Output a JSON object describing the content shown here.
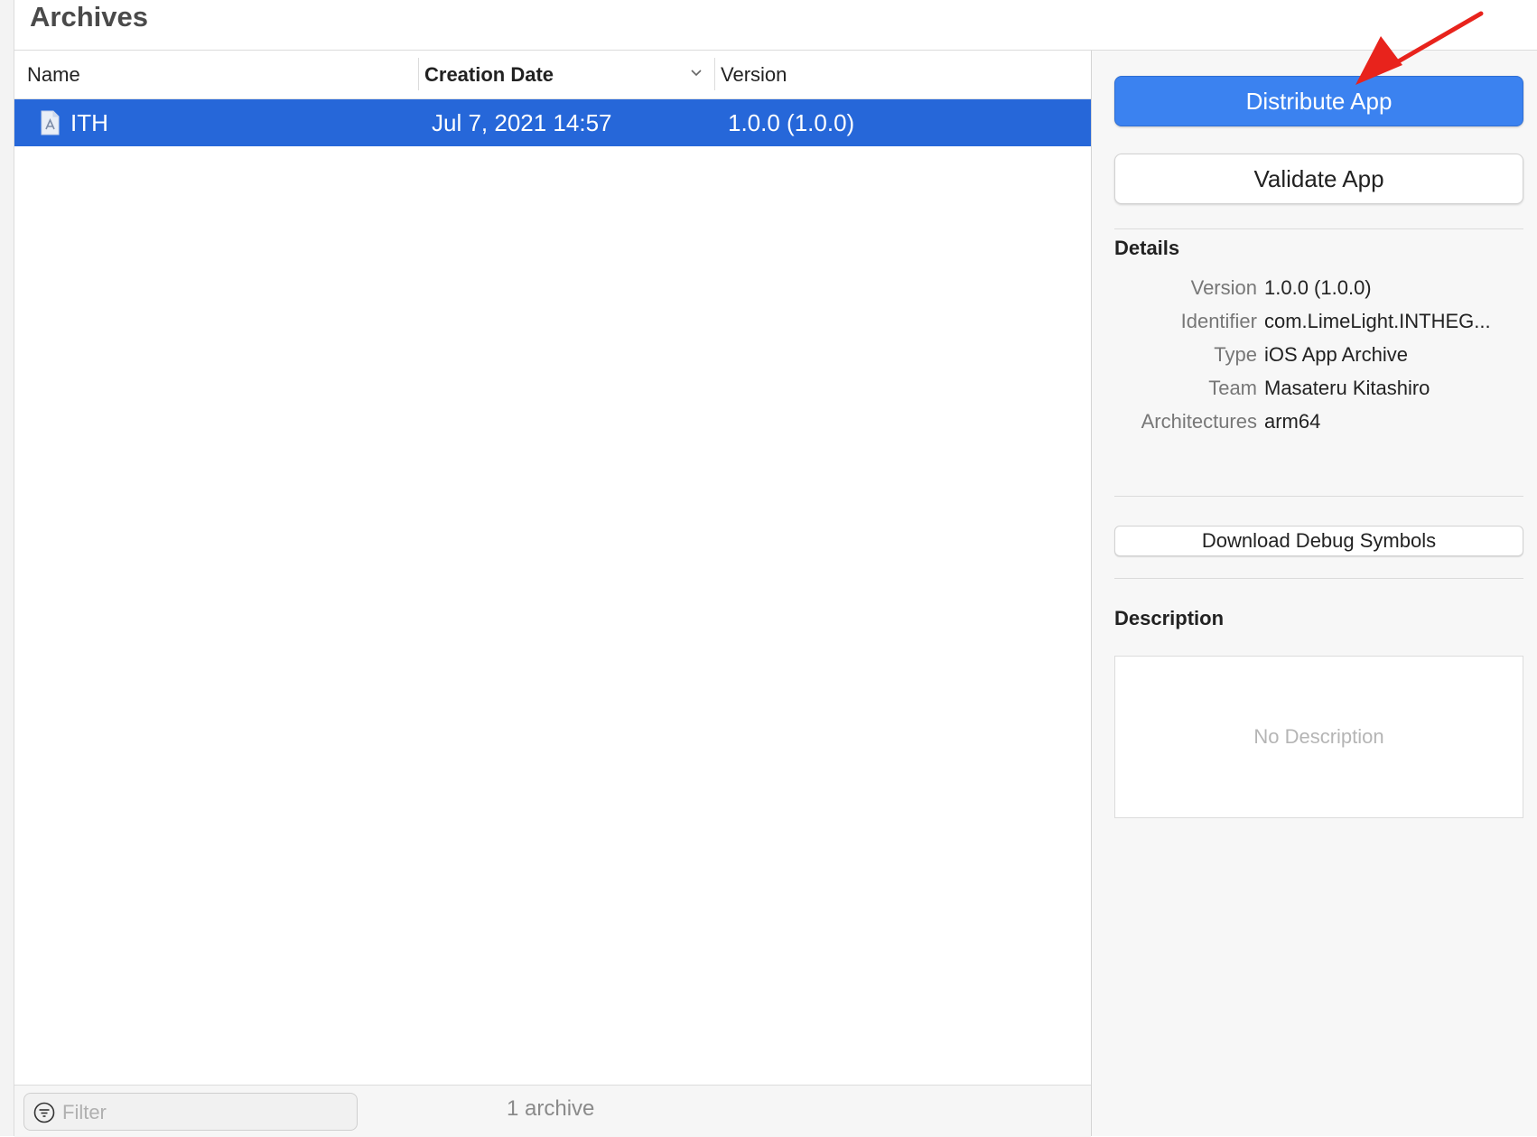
{
  "window": {
    "title": "Archives"
  },
  "columns": {
    "name": "Name",
    "creation_date": "Creation Date",
    "version": "Version"
  },
  "archives": [
    {
      "name": "ITH",
      "date": "Jul 7, 2021 14:57",
      "version": "1.0.0 (1.0.0)",
      "selected": true
    }
  ],
  "footer": {
    "filter_placeholder": "Filter",
    "count": "1 archive"
  },
  "actions": {
    "distribute": "Distribute App",
    "validate": "Validate App",
    "download_symbols": "Download Debug Symbols"
  },
  "details": {
    "title": "Details",
    "rows": [
      {
        "key": "Version",
        "value": "1.0.0 (1.0.0)"
      },
      {
        "key": "Identifier",
        "value": "com.LimeLight.INTHEG..."
      },
      {
        "key": "Type",
        "value": "iOS App Archive"
      },
      {
        "key": "Team",
        "value": "Masateru Kitashiro"
      },
      {
        "key": "Architectures",
        "value": "arm64"
      }
    ]
  },
  "description": {
    "title": "Description",
    "placeholder": "No Description"
  },
  "colors": {
    "selection": "#2667d9",
    "primary_button": "#3b82f0",
    "annotation_arrow": "#e8231c"
  },
  "icons": {
    "archive": "archive-file-icon",
    "filter": "filter-icon",
    "sort": "chevron-down-icon",
    "annotation": "red-arrow-icon"
  }
}
